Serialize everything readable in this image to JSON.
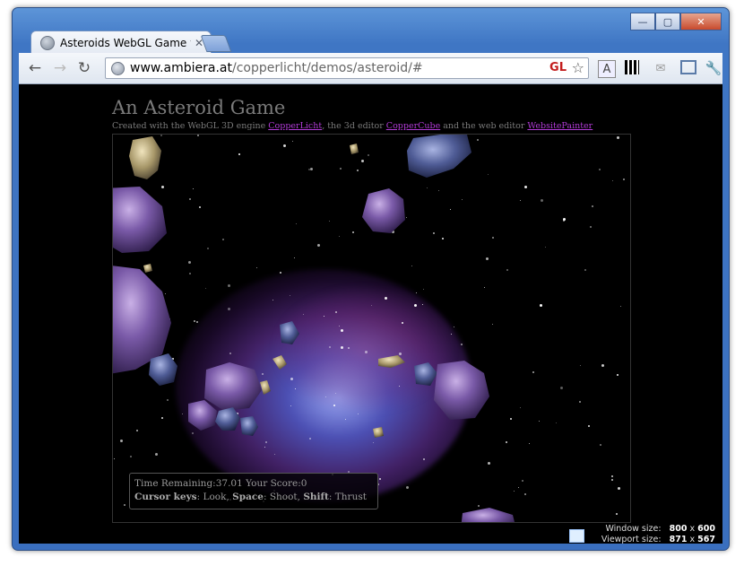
{
  "browser": {
    "tab_title": "Asteroids WebGL Game wit",
    "tab_close": "✕",
    "url_domain": "www.ambiera.at",
    "url_path": "/copperlicht/demos/asteroid/#",
    "gl_badge": "GL",
    "window_controls": [
      "—",
      "▢",
      "✕"
    ]
  },
  "page": {
    "title": "An Asteroid Game",
    "credits_prefix": "Created with the WebGL 3D engine ",
    "link1": "CopperLicht",
    "credits_mid": ", the 3d editor ",
    "link2": "CopperCube",
    "credits_mid2": " and the web editor ",
    "link3": "WebsitePainter"
  },
  "hud": {
    "time_label": "Time Remaining:",
    "time_value": "37.01",
    "score_label": "Your Score:",
    "score_value": "0",
    "keys1_label": "Cursor keys",
    "keys1_action": ": Look,",
    "keys2_label": "Space",
    "keys2_action": ": Shoot,",
    "keys3_label": "Shift",
    "keys3_action": ": Thrust"
  },
  "viewport_info": {
    "window_label": "Window size:",
    "window_w": "800",
    "window_x": "x",
    "window_h": "600",
    "viewport_label": "Viewport size:",
    "viewport_w": "871",
    "viewport_x": "x",
    "viewport_h": "567"
  },
  "colors": {
    "link": "#b13bd6",
    "text_muted": "#7a7a7a",
    "background": "#000000",
    "chrome_frame": "#3f76c4"
  }
}
